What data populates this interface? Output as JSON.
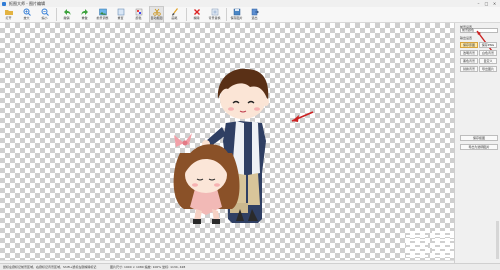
{
  "window": {
    "title": "抠图大师 - 图片编辑",
    "min": "–",
    "max": "□",
    "close": "×"
  },
  "toolbar": {
    "tools": [
      {
        "label": "打开"
      },
      {
        "label": "放大"
      },
      {
        "label": "缩小"
      },
      {
        "label": "撤销"
      },
      {
        "label": "重做"
      },
      {
        "label": "前景调整"
      },
      {
        "label": "重置"
      },
      {
        "label": "颜色"
      },
      {
        "label": "自动抠图"
      },
      {
        "label": "画笔"
      },
      {
        "label": "擦除"
      },
      {
        "label": "背景替换"
      },
      {
        "label": "保存图片"
      },
      {
        "label": "退出"
      }
    ],
    "active_index": 8
  },
  "panel": {
    "title": "前景设置",
    "field_value": "前景颜色",
    "sub_title": "输出设置",
    "buttons": [
      {
        "left": "保存原图",
        "right": "保存PNG"
      },
      {
        "left": "透明背景",
        "right": "白色背景"
      },
      {
        "left": "黑色背景",
        "right": "自定义"
      },
      {
        "left": "替换背景",
        "right": "导出图片"
      }
    ],
    "action_1": "保存抠图",
    "action_2": "导出为透明图片"
  },
  "status": {
    "left": "鼠标左键标记前景区域，右键标记背景区域，Shift+鼠标左键擦除标记",
    "right": "图片尺寸: 1900 × 1080   缩放: 100%   坐标: 1134, 428"
  }
}
